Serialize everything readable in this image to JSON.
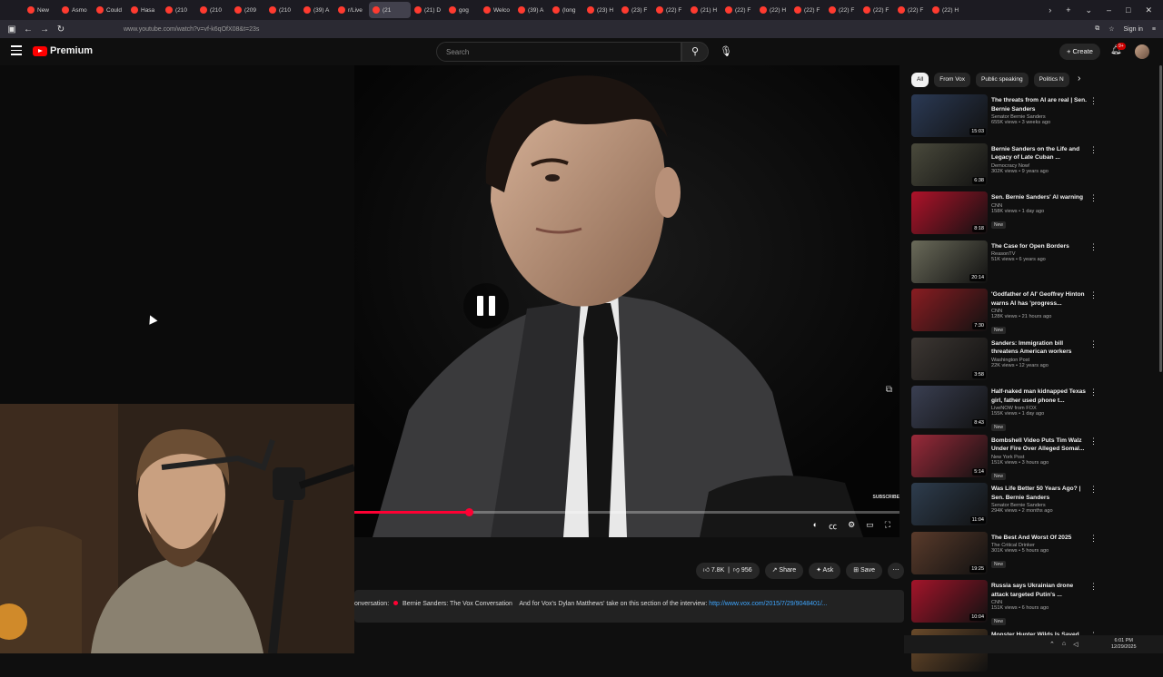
{
  "browser": {
    "tabs": [
      {
        "label": "New"
      },
      {
        "label": "Asmo"
      },
      {
        "label": "Could"
      },
      {
        "label": "Hasa"
      },
      {
        "label": "(210"
      },
      {
        "label": "(210"
      },
      {
        "label": "(209"
      },
      {
        "label": "(210"
      },
      {
        "label": "(39) A"
      },
      {
        "label": "r/Live"
      },
      {
        "label": "(21"
      },
      {
        "label": "(21) D"
      },
      {
        "label": "gog"
      },
      {
        "label": "Welco"
      },
      {
        "label": "(39) A"
      },
      {
        "label": "(long"
      },
      {
        "label": "(23) H"
      },
      {
        "label": "(23) F"
      },
      {
        "label": "(22) F"
      },
      {
        "label": "(21) H"
      },
      {
        "label": "(22) F"
      },
      {
        "label": "(22) H"
      },
      {
        "label": "(22) F"
      },
      {
        "label": "(22) F"
      },
      {
        "label": "(22) F"
      },
      {
        "label": "(22) F"
      },
      {
        "label": "(22) H"
      }
    ],
    "active_tab_index": 10,
    "url": "www.youtube.com/watch?v=vf-k6qOfX08&t=23s",
    "sign_in": "Sign in"
  },
  "youtube": {
    "logo_text": "Premium",
    "search_placeholder": "Search",
    "create_label": "Create",
    "notification_count": "9+"
  },
  "player": {
    "progress_fraction": 0.21,
    "subscribe_watermark": "SUBSCRIBE"
  },
  "actions": {
    "likes": "7.8K",
    "dislikes": "956",
    "share": "Share",
    "ask": "Ask",
    "save": "Save"
  },
  "description": {
    "prefix": "onversation:",
    "playlist_link": "Bernie Sanders: The Vox Conversation",
    "text": "And for Vox's Dylan Matthews' take on this section of the interview:",
    "url": "http://www.vox.com/2015/7/29/9048401/..."
  },
  "chips": [
    "All",
    "From Vox",
    "Public speaking",
    "Politics N"
  ],
  "recommendations": [
    {
      "title": "The threats from AI are real | Sen. Bernie Sanders",
      "channel": "Senator Bernie Sanders",
      "views": "655K views • 3 weeks ago",
      "duration": "15:03",
      "thumb_color": "#2b3a55",
      "new": ""
    },
    {
      "title": "Bernie Sanders on the Life and Legacy of Late Cuban ...",
      "channel": "Democracy Now!",
      "views": "302K views • 9 years ago",
      "duration": "6:38",
      "thumb_color": "#4a4a3c",
      "new": ""
    },
    {
      "title": "Sen. Bernie Sanders' AI warning",
      "channel": "CNN",
      "views": "158K views • 1 day ago",
      "duration": "8:18",
      "thumb_color": "#b0122a",
      "new": "New"
    },
    {
      "title": "The Case for Open Borders",
      "channel": "ReasonTV",
      "views": "51K views • 6 years ago",
      "duration": "20:14",
      "thumb_color": "#6b6b5a",
      "new": ""
    },
    {
      "title": "'Godfather of AI' Geoffrey Hinton warns AI has 'progress...",
      "channel": "CNN",
      "views": "128K views • 21 hours ago",
      "duration": "7:30",
      "thumb_color": "#8a1d22",
      "new": "New"
    },
    {
      "title": "Sanders: Immigration bill threatens American workers",
      "channel": "Washington Post",
      "views": "22K views • 12 years ago",
      "duration": "3:58",
      "thumb_color": "#3d3733",
      "new": ""
    },
    {
      "title": "Half-naked man kidnapped Texas girl, father used phone t...",
      "channel": "LiveNOW from FOX",
      "views": "155K views • 1 day ago",
      "duration": "8:43",
      "thumb_color": "#3a3f52",
      "new": "New"
    },
    {
      "title": "Bombshell Video Puts Tim Walz Under Fire Over Alleged Somal...",
      "channel": "New York Post",
      "views": "151K views • 3 hours ago",
      "duration": "5:14",
      "thumb_color": "#9a2a3a",
      "new": "New"
    },
    {
      "title": "Was Life Better 50 Years Ago? | Sen. Bernie Sanders",
      "channel": "Senator Bernie Sanders",
      "views": "294K views • 2 months ago",
      "duration": "11:04",
      "thumb_color": "#2e3d4e",
      "new": ""
    },
    {
      "title": "The Best And Worst Of 2025",
      "channel": "The Critical Drinker",
      "views": "301K views • 5 hours ago",
      "duration": "19:25",
      "thumb_color": "#5a3b2b",
      "new": "New"
    },
    {
      "title": "Russia says Ukrainian drone attack targeted Putin's ...",
      "channel": "CNN",
      "views": "151K views • 6 hours ago",
      "duration": "10:04",
      "thumb_color": "#a4142a",
      "new": "New"
    },
    {
      "title": "Monster Hunter Wilds Is Saved",
      "channel": "",
      "views": "",
      "duration": "",
      "thumb_color": "#6a4a2a",
      "new": ""
    }
  ],
  "taskbar": {
    "time": "6:01 PM",
    "date": "12/29/2025"
  }
}
